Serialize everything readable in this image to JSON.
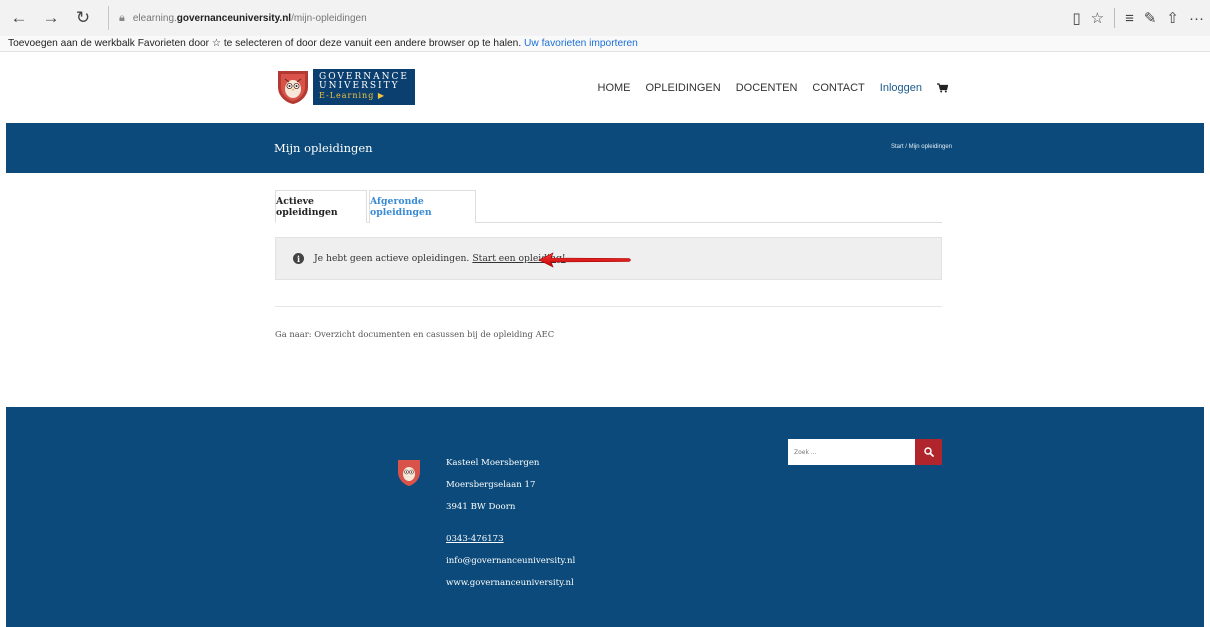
{
  "browser": {
    "url_prefix": "elearning.",
    "url_domain": "governanceuniversity.nl",
    "url_path": "/mijn-opleidingen",
    "favorites_text": "Toevoegen aan de werkbalk Favorieten door ☆ te selecteren of door deze vanuit een andere browser op te halen.",
    "favorites_link": "Uw favorieten importeren"
  },
  "header": {
    "logo_line1": "GOVERNANCE",
    "logo_line2": "UNIVERSITY",
    "logo_line3": "E-Learning ▶",
    "nav": [
      "HOME",
      "OPLEIDINGEN",
      "DOCENTEN",
      "CONTACT"
    ],
    "login": "Inloggen"
  },
  "title_bar": {
    "title": "Mijn opleidingen",
    "breadcrumb": "Start / Mijn opleidingen"
  },
  "tabs": [
    "Actieve opleidingen",
    "Afgeronde opleidingen"
  ],
  "notice": {
    "text": "Je hebt geen actieve opleidingen.",
    "link": "Start een opleiding!"
  },
  "goto_text": "Ga naar: Overzicht documenten en casussen bij de opleiding AEC",
  "footer": {
    "address": [
      "Kasteel Moersbergen",
      "Moersbergselaan 17",
      "3941 BW Doorn"
    ],
    "phone": "0343-476173",
    "email": "info@governanceuniversity.nl",
    "website": "www.governanceuniversity.nl",
    "search_placeholder": "Zoek ..."
  },
  "colors": {
    "brand_blue": "#0b4a7a",
    "accent_red": "#b0242b",
    "link_blue": "#3a8bd6"
  }
}
